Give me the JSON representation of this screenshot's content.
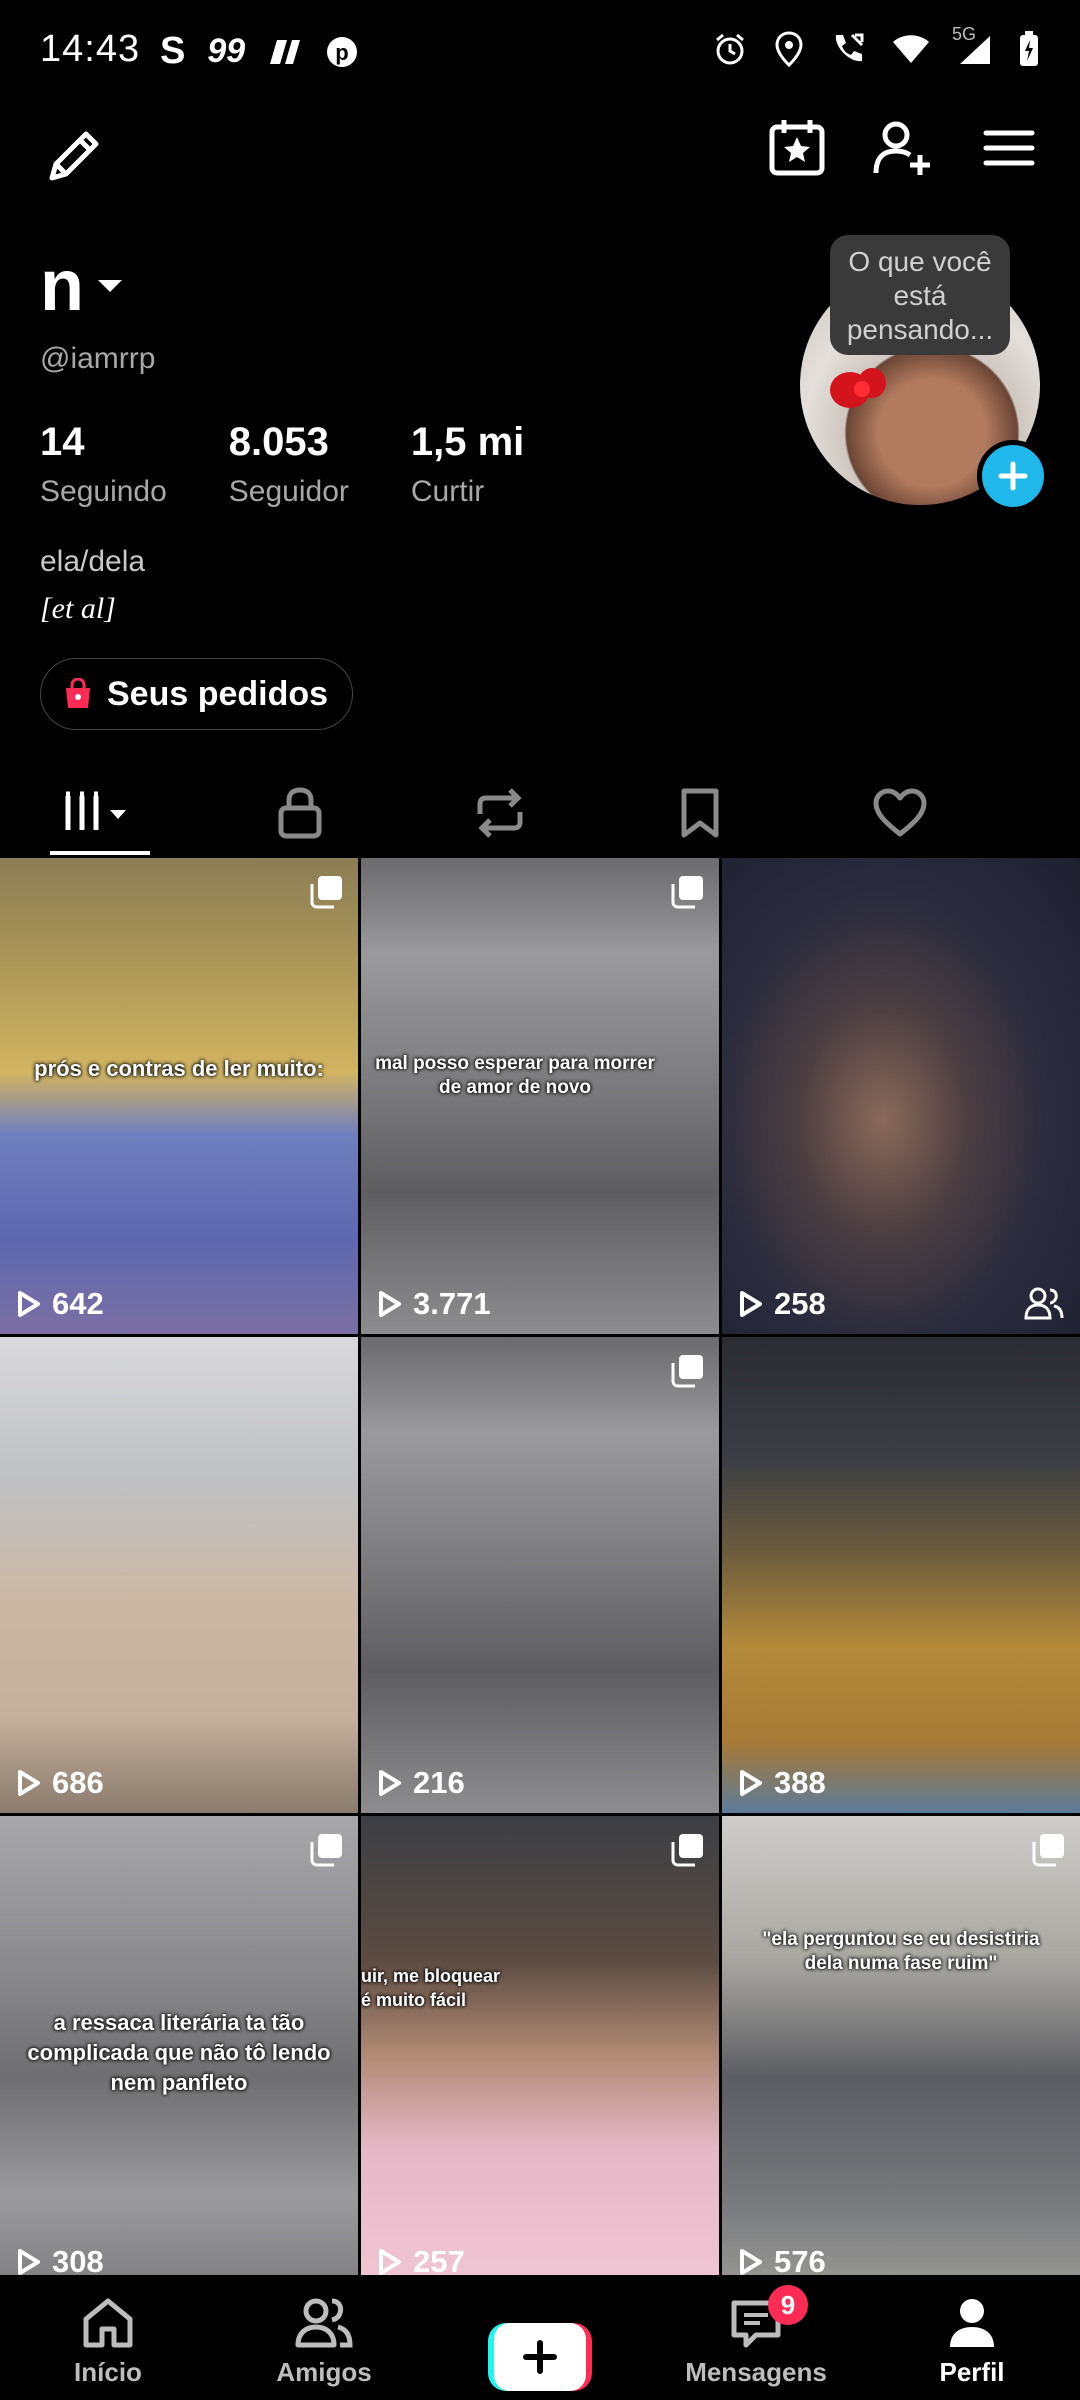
{
  "status_bar": {
    "time": "14:43",
    "left_icons": [
      "s-app-icon",
      "99-app-icon",
      "n-app-icon",
      "pinterest-icon"
    ],
    "right_icons": [
      "alarm-icon",
      "location-icon",
      "call-icon",
      "wifi-icon",
      "signal-5g-icon",
      "battery-icon"
    ],
    "network": "5G"
  },
  "header": {
    "icons": [
      "pencil-icon",
      "calendar-star-icon",
      "add-user-icon",
      "menu-icon"
    ]
  },
  "profile": {
    "name": "n",
    "handle": "@iamrrp",
    "stats": [
      {
        "value": "14",
        "label": "Seguindo"
      },
      {
        "value": "8.053",
        "label": "Seguidor"
      },
      {
        "value": "1,5 mi",
        "label": "Curtir"
      }
    ],
    "pronouns": "ela/dela",
    "bio": "[et al]",
    "orders_label": "Seus pedidos",
    "note_bubble": "O que você está pensando..."
  },
  "tabs": [
    "videos-grid-icon",
    "lock-icon",
    "repost-icon",
    "bookmark-icon",
    "heart-icon"
  ],
  "videos": [
    {
      "views": "642",
      "caption": "prós e contras de ler muito:",
      "multi": true,
      "friends": false
    },
    {
      "views": "3.771",
      "caption": "mal posso esperar para morrer de amor de novo",
      "multi": true,
      "friends": false
    },
    {
      "views": "258",
      "caption": "",
      "multi": false,
      "friends": true
    },
    {
      "views": "686",
      "caption": "",
      "multi": false,
      "friends": false
    },
    {
      "views": "216",
      "caption": "",
      "multi": true,
      "friends": false
    },
    {
      "views": "388",
      "caption": "",
      "multi": false,
      "friends": false
    },
    {
      "views": "308",
      "caption": "a ressaca literária ta tão complicada que não tô lendo nem panfleto",
      "multi": true,
      "friends": false
    },
    {
      "views": "257",
      "caption": "uir, me bloquear é muito fácil",
      "multi": true,
      "friends": false
    },
    {
      "views": "576",
      "caption": "\"ela perguntou se eu desistiria dela numa fase ruim\"",
      "multi": true,
      "friends": false
    }
  ],
  "bottom_nav": {
    "home": "Início",
    "friends": "Amigos",
    "messages": "Mensagens",
    "messages_badge": "9",
    "profile": "Perfil"
  }
}
